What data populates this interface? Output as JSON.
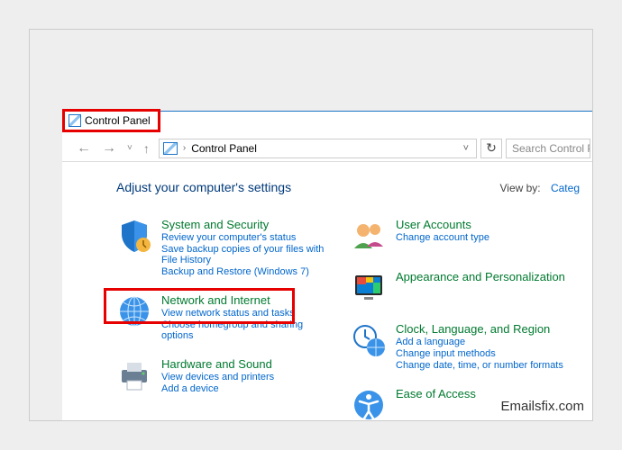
{
  "window": {
    "title": "Control Panel"
  },
  "addrbar": {
    "path": "Control Panel",
    "search_placeholder": "Search Control P"
  },
  "header": {
    "title": "Adjust your computer's settings",
    "viewby_label": "View by:",
    "viewby_value": "Categ"
  },
  "categories": {
    "left": [
      {
        "title": "System and Security",
        "links": [
          "Review your computer's status",
          "Save backup copies of your files with File History",
          "Backup and Restore (Windows 7)"
        ]
      },
      {
        "title": "Network and Internet",
        "links": [
          "View network status and tasks",
          "Choose homegroup and sharing options"
        ]
      },
      {
        "title": "Hardware and Sound",
        "links": [
          "View devices and printers",
          "Add a device"
        ]
      }
    ],
    "right": [
      {
        "title": "User Accounts",
        "links": [
          "Change account type"
        ]
      },
      {
        "title": "Appearance and Personalization",
        "links": []
      },
      {
        "title": "Clock, Language, and Region",
        "links": [
          "Add a language",
          "Change input methods",
          "Change date, time, or number formats"
        ]
      },
      {
        "title": "Ease of Access",
        "links": []
      }
    ]
  },
  "brand": "Emailsfix.com"
}
